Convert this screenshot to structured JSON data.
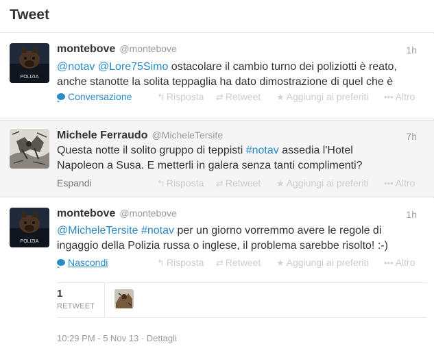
{
  "header": {
    "title": "Tweet"
  },
  "tweets": [
    {
      "fullname": "montebove",
      "handle": "@montebove",
      "time": "1h",
      "line1": [
        {
          "t": "@notav",
          "k": "mention"
        },
        {
          "t": " ",
          "k": "text"
        },
        {
          "t": "@Lore75Simo",
          "k": "mention"
        },
        {
          "t": " ostacolare il cambio turno dei poliziotti è reato,",
          "k": "text"
        }
      ],
      "line2": [
        {
          "t": "anche stanotte la solita teppaglia ha dato dimostrazione di quel che è",
          "k": "text"
        }
      ],
      "expand_label": "Conversazione",
      "actions": {
        "reply": "Risposta",
        "retweet": "Retweet",
        "favorite": "Aggiungi ai preferiti",
        "more": "Altro"
      }
    },
    {
      "fullname": "Michele Ferraudo",
      "handle": "@MicheleTersite",
      "time": "7h",
      "line1": [
        {
          "t": "Questa notte il solito gruppo di teppisti ",
          "k": "text"
        },
        {
          "t": "#notav",
          "k": "hashtag"
        },
        {
          "t": " assedia l'Hotel",
          "k": "text"
        }
      ],
      "line2": [
        {
          "t": "Napoleon a Susa. E metterli in galera senza tanti complimenti?",
          "k": "text"
        }
      ],
      "expand_label": "Espandi",
      "actions": {
        "reply": "Risposta",
        "retweet": "Retweet",
        "favorite": "Aggiungi ai preferiti",
        "more": "Altro"
      }
    },
    {
      "fullname": "montebove",
      "handle": "@montebove",
      "time": "1h",
      "line1": [
        {
          "t": "@MicheleTersite",
          "k": "mention"
        },
        {
          "t": " ",
          "k": "text"
        },
        {
          "t": "#notav",
          "k": "hashtag"
        },
        {
          "t": " per un giorno vorremmo avere le regole di",
          "k": "text"
        }
      ],
      "line2": [
        {
          "t": "ingaggio della Polizia russa o inglese, il problema sarebbe risolto! :-)",
          "k": "text"
        }
      ],
      "expand_label": "Nascondi",
      "actions": {
        "reply": "Risposta",
        "retweet": "Retweet",
        "favorite": "Aggiungi ai preferiti",
        "more": "Altro"
      },
      "stats": {
        "retweet_count": "1",
        "retweet_label": "RETWEET"
      },
      "meta": {
        "timestamp": "10:29 PM - 5 Nov 13",
        "separator": " · ",
        "details": "Dettagli"
      }
    }
  ],
  "icons": {
    "reply": "reply-arrow",
    "retweet": "retweet-arrows",
    "favorite": "star",
    "more": "three-dots",
    "conversation": "speech-bubble"
  },
  "colors": {
    "link": "#2a8ac4",
    "muted": "#999999",
    "action": "#cccccc",
    "selected_bg": "#f5f5f5"
  }
}
